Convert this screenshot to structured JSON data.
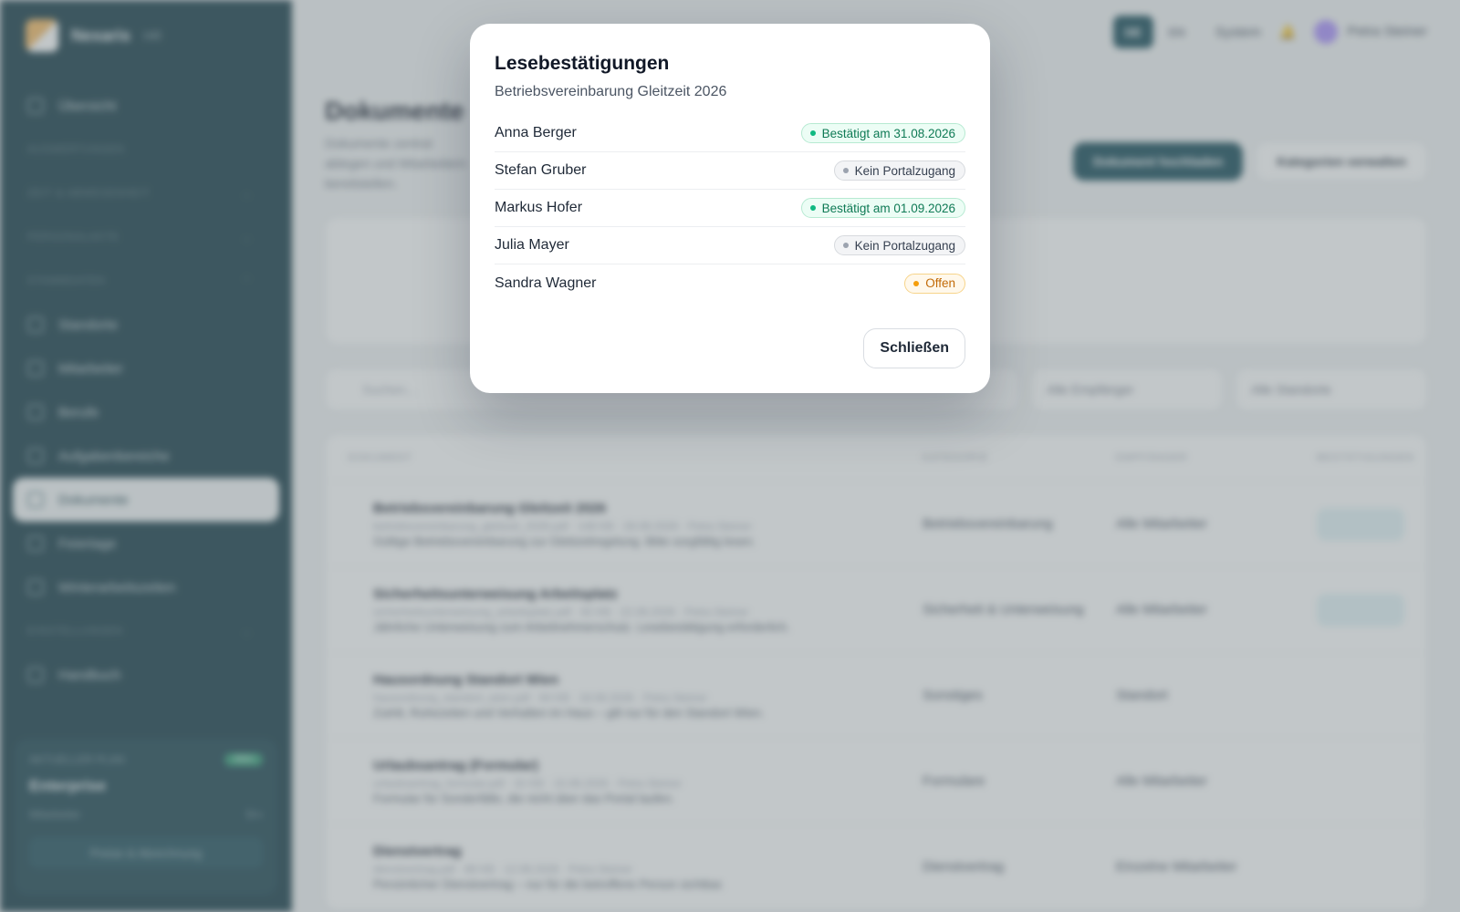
{
  "app": {
    "brand": "Nexaris",
    "brand_suffix": "HR",
    "nav": {
      "overview": "Übersicht",
      "group1": "AUSWERTUNGEN",
      "group2": "ZEIT & ABWESENHEIT",
      "group3": "PERSONALAKTE",
      "group4": "STAMMDATEN",
      "standorte": "Standorte",
      "mitarbeiter": "Mitarbeiter",
      "berufe": "Berufe",
      "aufgaben": "Aufgabenbereiche",
      "dokumente": "Dokumente",
      "feiertage": "Feiertage",
      "wintervortheil": "Winterarbeitszeiten",
      "group5": "EINSTELLUNGEN",
      "handbuch": "Handbuch"
    },
    "plan_card": {
      "label": "AKTUELLER PLAN",
      "badge": "Aktiv",
      "plan": "Enterprise",
      "seats_label": "Mitarbeiter",
      "seats_value": "5/∞",
      "button": "Preise & Abrechnung"
    },
    "topbar": {
      "lang_de": "DE",
      "lang_en": "EN",
      "system": "System",
      "user": "Petra Steiner"
    },
    "page": {
      "title": "Dokumente",
      "subtitle": "Dokumente zentral ablegen und Mitarbeitern bereitstellen.",
      "upload_button": "Dokument hochladen",
      "categories_button": "Kategorien verwalten"
    },
    "filters": {
      "search_placeholder": "Suchen...",
      "recipients": "Alle Empfänger",
      "locations": "Alle Standorte"
    },
    "table": {
      "headers": [
        "DOKUMENT",
        "KATEGORIE",
        "EMPFÄNGER",
        "BESTÄTIGUNGEN"
      ],
      "rows": [
        {
          "title": "Betriebsvereinbarung Gleitzeit 2026",
          "meta": "betriebsvereinbarung_gleitzeit_2026.pdf · 148 KB · 28.08.2026 · Petra Steiner",
          "desc": "Gültige Betriebsvereinbarung zur Gleitzeitregelung. Bitte sorgfältig lesen.",
          "category": "Betriebsvereinbarung",
          "recipient": "Alle Mitarbeiter"
        },
        {
          "title": "Sicherheitsunterweisung Arbeitsplatz",
          "meta": "sicherheitsunterweisung_arbeitsplatz.pdf · 92 KB · 22.08.2026 · Petra Steiner",
          "desc": "Jährliche Unterweisung zum Arbeitnehmerschutz. Lesebestätigung erforderlich.",
          "category": "Sicherheit & Unterweisung",
          "recipient": "Alle Mitarbeiter"
        },
        {
          "title": "Hausordnung Standort Wien",
          "meta": "hausordnung_standort_wien.pdf · 64 KB · 18.08.2026 · Petra Steiner",
          "desc": "Zutritt, Ruhezeiten und Verhalten im Haus – gilt nur für den Standort Wien.",
          "category": "Sonstiges",
          "recipient": "Standort"
        },
        {
          "title": "Urlaubsantrag (Formular)",
          "meta": "urlaubsantrag_formular.pdf · 32 KB · 15.08.2026 · Petra Steiner",
          "desc": "Formular für Sonderfälle, die nicht über das Portal laufen.",
          "category": "Formulare",
          "recipient": "Alle Mitarbeiter"
        },
        {
          "title": "Dienstvertrag",
          "meta": "dienstvertrag.pdf · 88 KB · 12.08.2026 · Petra Steiner",
          "desc": "Persönlicher Dienstvertrag – nur für die betroffene Person sichtbar.",
          "category": "Dienstvertrag",
          "recipient": "Einzelne Mitarbeiter"
        }
      ]
    }
  },
  "modal": {
    "title": "Lesebestätigungen",
    "subtitle": "Betriebsvereinbarung Gleitzeit 2026",
    "entries": [
      {
        "name": "Anna Berger",
        "status": "Bestätigt am 31.08.2026",
        "kind": "confirmed"
      },
      {
        "name": "Stefan Gruber",
        "status": "Kein Portalzugang",
        "kind": "no-access"
      },
      {
        "name": "Markus Hofer",
        "status": "Bestätigt am 01.09.2026",
        "kind": "confirmed"
      },
      {
        "name": "Julia Mayer",
        "status": "Kein Portalzugang",
        "kind": "no-access"
      },
      {
        "name": "Sandra Wagner",
        "status": "Offen",
        "kind": "open"
      }
    ],
    "close_label": "Schließen"
  },
  "colors": {
    "sidebar": "#0e3440",
    "accent": "#0e4452",
    "confirmed": "#0f7a55",
    "open": "#c26a07"
  }
}
